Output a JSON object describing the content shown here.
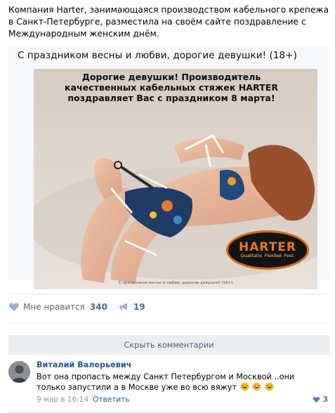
{
  "post": {
    "text": "Компания Harter, занимающаяся производством кабельного крепежа в Санкт-Петербурге, разместила на своём сайте поздравление с Международным женским днём."
  },
  "attachment": {
    "title": "С праздником весны и любви, дорогие девушки! (18+)",
    "overlay_text": "Дорогие девушки! Производитель качественных кабельных стяжек HARTER поздравляет Вас с праздником 8 марта!",
    "logo_name": "HARTER",
    "logo_slogan": "Qualitativ. Flexibel. Fest.",
    "caption": "С праздником весны и любви, дорогие девушки! (18+)"
  },
  "actions": {
    "like_label": "Мне нравится",
    "like_count": "340",
    "share_count": "19"
  },
  "comments": {
    "hide_label": "Скрыть комментарии",
    "items": [
      {
        "author": "Виталий Валерьевич",
        "text": "Вот она пропасть между Санкт Петербургом и Москвой ..они только запустили а в Москве уже во всю вяжут",
        "date": "9 мар в 16:14",
        "reply_label": "Ответить",
        "likes": "3"
      }
    ]
  },
  "colors": {
    "link": "#2a5885",
    "muted": "#656565",
    "logo_orange": "#e7761c",
    "logo_bg": "#131313"
  }
}
